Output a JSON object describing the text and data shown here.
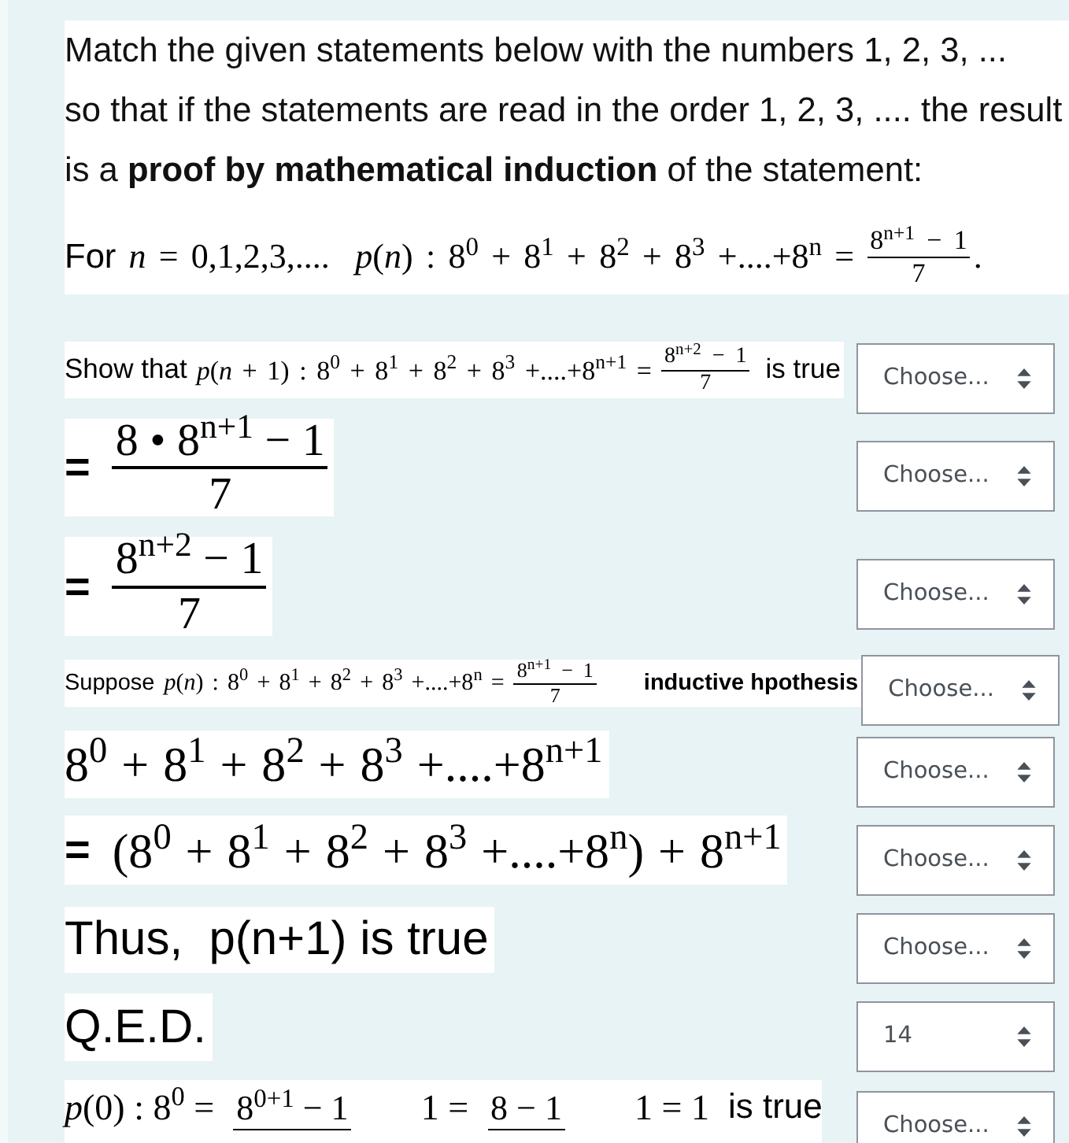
{
  "question": {
    "lines": [
      "Match the given statements below with the numbers 1, 2, 3, ...",
      "so that if the statements are read in the order 1, 2, 3, .... the result",
      "is a **proof by mathematical induction** of the statement:"
    ],
    "statement": [
      {
        "kind": "text",
        "text": "For"
      },
      {
        "kind": "math",
        "text": "*n* = 0,1,2,3,....  *p*(*n*) : 8$^{0}$ + 8$^{1}$ + 8$^{2}$ + 8$^{3}$ +....+8$^{n}$ ="
      },
      {
        "kind": "fraction",
        "numerator": "8$^{n+1}$ − 1",
        "denominator": "7"
      },
      {
        "kind": "math",
        "text": "."
      }
    ]
  },
  "items": [
    {
      "statement": [
        {
          "kind": "text",
          "text": "Show that"
        },
        {
          "kind": "math",
          "text": "*p*(*n* + 1) : 8$^{0}$ + 8$^{1}$ + 8$^{2}$ + 8$^{3}$ +....+8$^{n+1}$ ="
        },
        {
          "kind": "fraction",
          "numerator": "8$^{n+2}$ − 1",
          "denominator": "7"
        },
        {
          "kind": "text",
          "text": "is true"
        }
      ],
      "answer": {
        "value": "Choose..."
      }
    },
    {
      "statement": [
        {
          "kind": "text",
          "text": "="
        },
        {
          "kind": "fraction",
          "numerator": "8 • 8$^{n+1}$ − 1",
          "denominator": "7"
        }
      ],
      "answer": {
        "value": "Choose..."
      }
    },
    {
      "statement": [
        {
          "kind": "text",
          "text": "="
        },
        {
          "kind": "fraction",
          "numerator": "8$^{n+2}$ − 1",
          "denominator": "7"
        }
      ],
      "answer": {
        "value": "Choose..."
      }
    },
    {
      "statement": [
        {
          "kind": "text",
          "text": "Suppose"
        },
        {
          "kind": "math",
          "text": "*p*(*n*) : 8$^{0}$ + 8$^{1}$ + 8$^{2}$ + 8$^{3}$ +....+8$^{n}$ ="
        },
        {
          "kind": "fraction",
          "numerator": "8$^{n+1}$ − 1",
          "denominator": "7"
        },
        {
          "kind": "emphasis",
          "text": "inductive hpothesis"
        }
      ],
      "answer": {
        "value": "Choose..."
      }
    },
    {
      "statement": [
        {
          "kind": "math",
          "text": "8$^{0}$ + 8$^{1}$ + 8$^{2}$ + 8$^{3}$ +....+8$^{n+1}$"
        }
      ],
      "answer": {
        "value": "Choose..."
      }
    },
    {
      "statement": [
        {
          "kind": "text",
          "text": "="
        },
        {
          "kind": "math",
          "text": "(8$^{0}$ + 8$^{1}$ + 8$^{2}$ + 8$^{3}$ +....+8$^{n}$) + 8$^{n+1}$"
        }
      ],
      "answer": {
        "value": "Choose..."
      }
    },
    {
      "statement": [
        {
          "kind": "text",
          "text": "Thus,  p(n+1) is true"
        }
      ],
      "answer": {
        "value": "Choose..."
      }
    },
    {
      "statement": [
        {
          "kind": "text",
          "text": "Q.E.D."
        }
      ],
      "answer": {
        "value": "14"
      }
    },
    {
      "statement": [
        {
          "kind": "math",
          "text": "*p*(0) : 8$^{0}$ ="
        },
        {
          "kind": "fraction",
          "numerator": "8$^{0+1}$ − 1"
        },
        {
          "kind": "math",
          "text": "1 ="
        },
        {
          "kind": "fraction",
          "numerator": "8 − 1"
        },
        {
          "kind": "math",
          "text": "1 = 1"
        },
        {
          "kind": "text",
          "text": "is true"
        }
      ],
      "answer": {
        "value": "Choose..."
      }
    }
  ]
}
